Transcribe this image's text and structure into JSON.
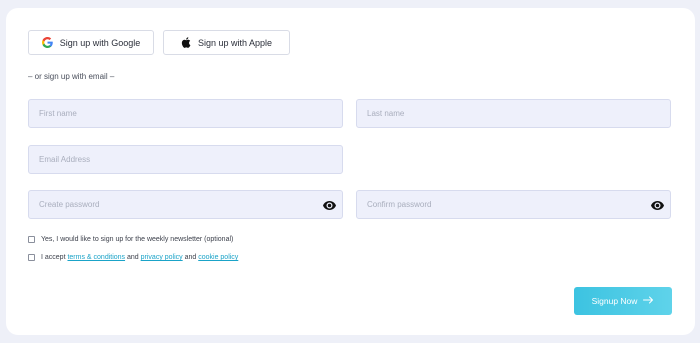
{
  "social": {
    "google_label": "Sign up with Google",
    "apple_label": "Sign up with Apple"
  },
  "divider_text": "– or sign up with email –",
  "form": {
    "first_name_placeholder": "First name",
    "last_name_placeholder": "Last name",
    "email_placeholder": "Email Address",
    "password_placeholder": "Create password",
    "confirm_placeholder": "Confirm password"
  },
  "checkboxes": {
    "newsletter_label": "Yes, I would like to sign up for the weekly newsletter (optional)",
    "accept_prefix": "I accept ",
    "terms_link": "terms & conditions",
    "and_1": " and ",
    "privacy_link": "privacy policy",
    "and_2": " and ",
    "cookie_link": "cookie policy"
  },
  "submit": {
    "label": "Signup Now",
    "arrow_icon": "arrow-right-icon"
  },
  "icons": {
    "google": "google-logo-icon",
    "apple": "apple-logo-icon",
    "eye": "eye-icon"
  },
  "colors": {
    "accent": "#3cc3e1",
    "link": "#1aa3c8",
    "field_bg": "#eef0fb",
    "page_bg": "#eef0f8"
  }
}
